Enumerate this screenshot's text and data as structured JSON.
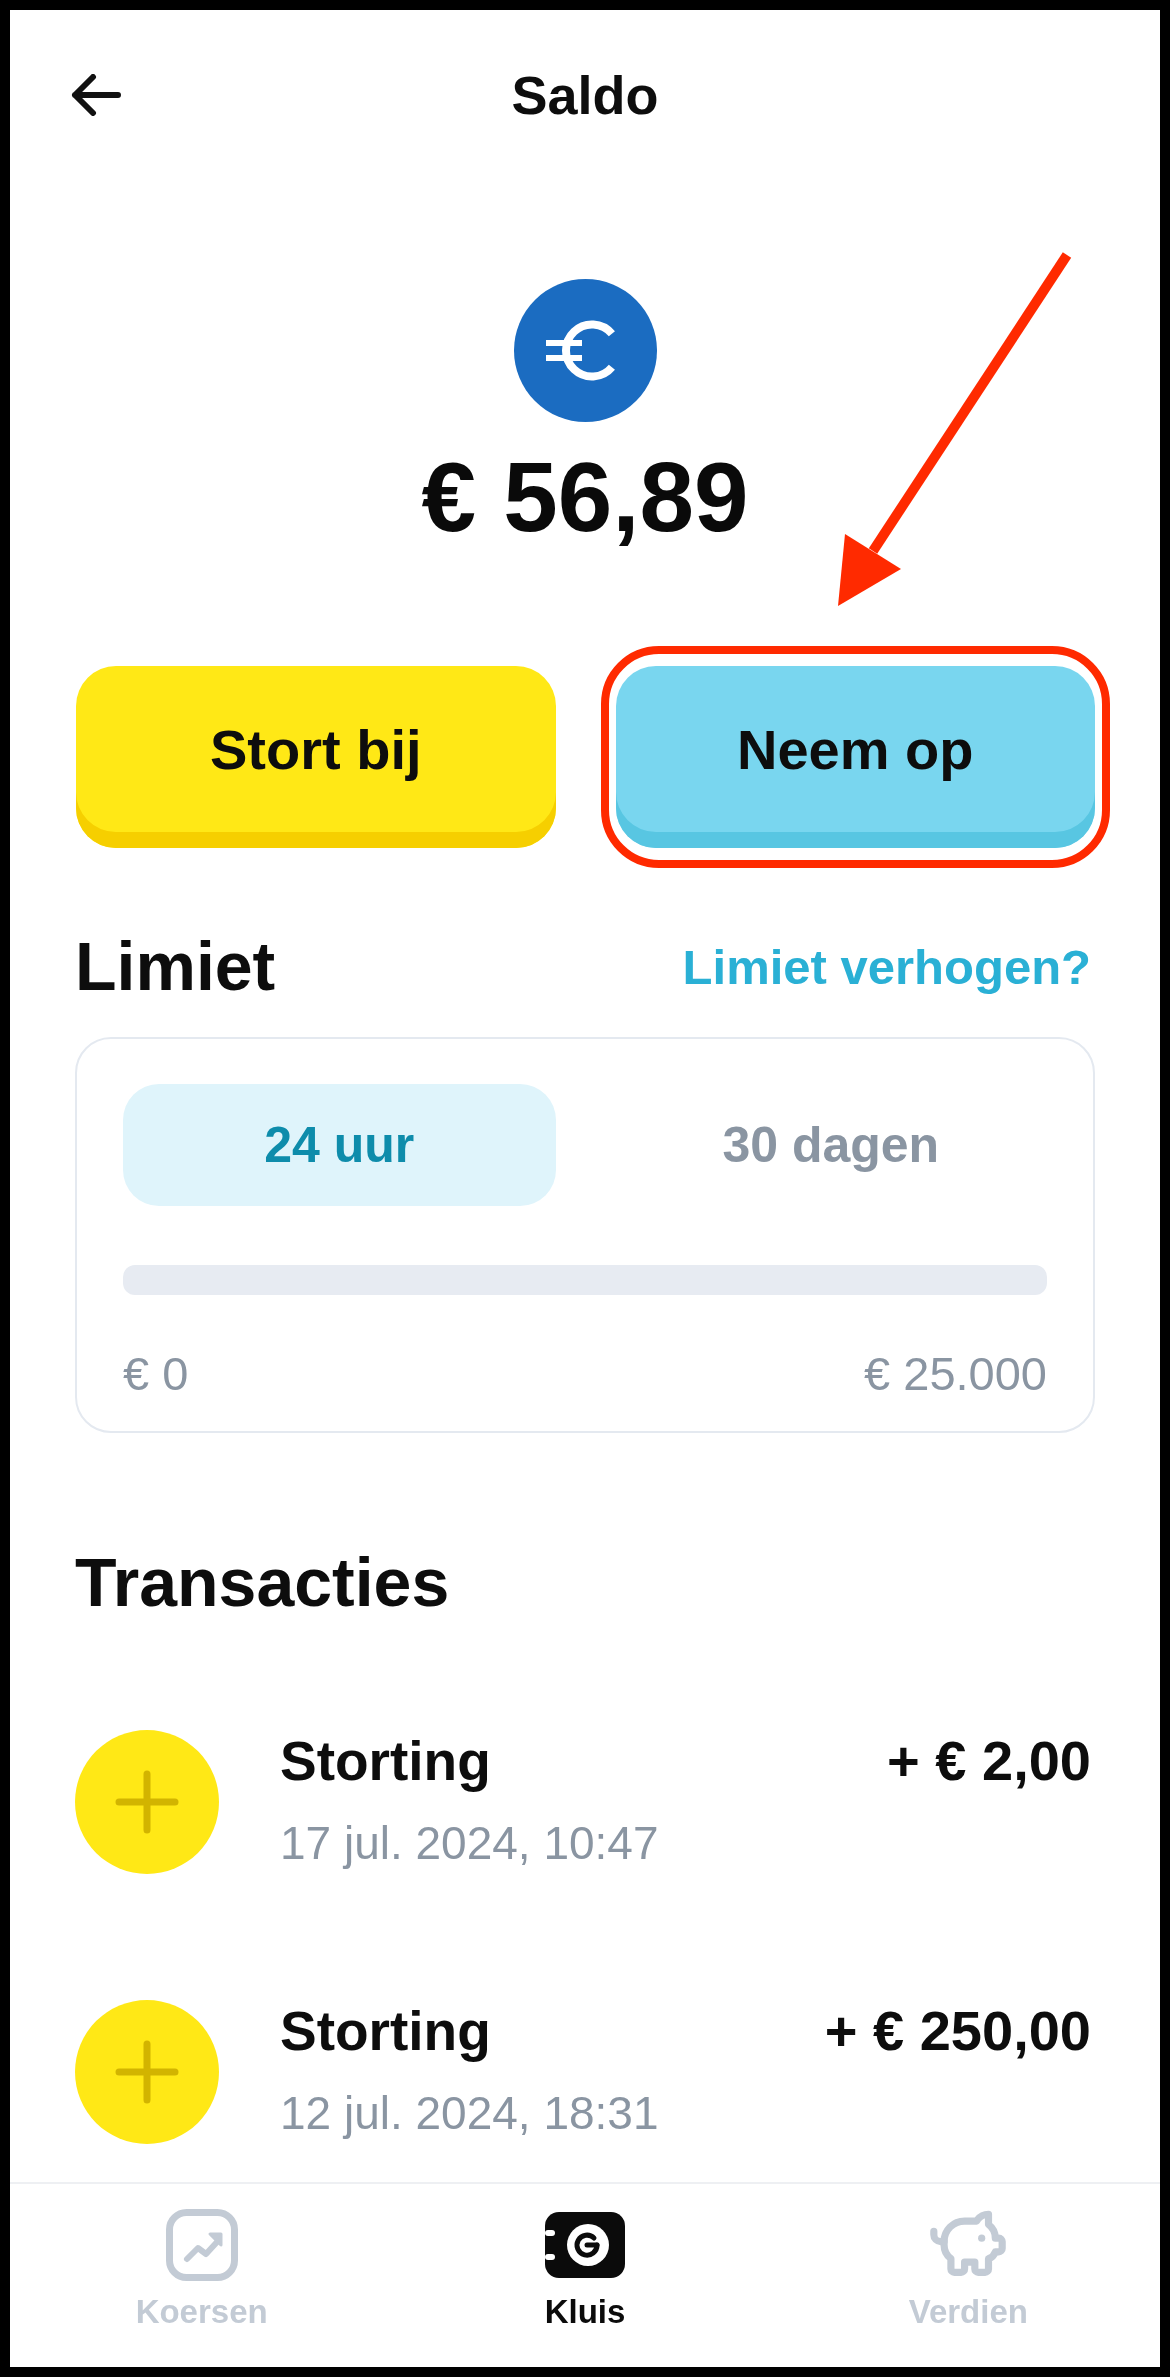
{
  "header": {
    "title": "Saldo"
  },
  "balance": {
    "amount": "€ 56,89"
  },
  "actions": [
    {
      "label": "Stort bij",
      "kind": "deposit",
      "highlighted": false
    },
    {
      "label": "Neem op",
      "kind": "withdraw",
      "highlighted": true
    }
  ],
  "limit": {
    "title": "Limiet",
    "link": "Limiet verhogen?",
    "periods": [
      {
        "label": "24 uur",
        "selected": true
      },
      {
        "label": "30 dagen",
        "selected": false
      }
    ],
    "min_label": "€ 0",
    "max_label": "€ 25.000"
  },
  "transactions": {
    "title": "Transacties",
    "items": [
      {
        "title": "Storting",
        "date": "17 jul. 2024, 10:47",
        "amount": "+ € 2,00"
      },
      {
        "title": "Storting",
        "date": "12 jul. 2024, 18:31",
        "amount": "+ € 250,00"
      }
    ]
  },
  "tab_bar": [
    {
      "label": "Koersen",
      "selected": false
    },
    {
      "label": "Kluis",
      "selected": true
    },
    {
      "label": "Verdien",
      "selected": false
    }
  ]
}
